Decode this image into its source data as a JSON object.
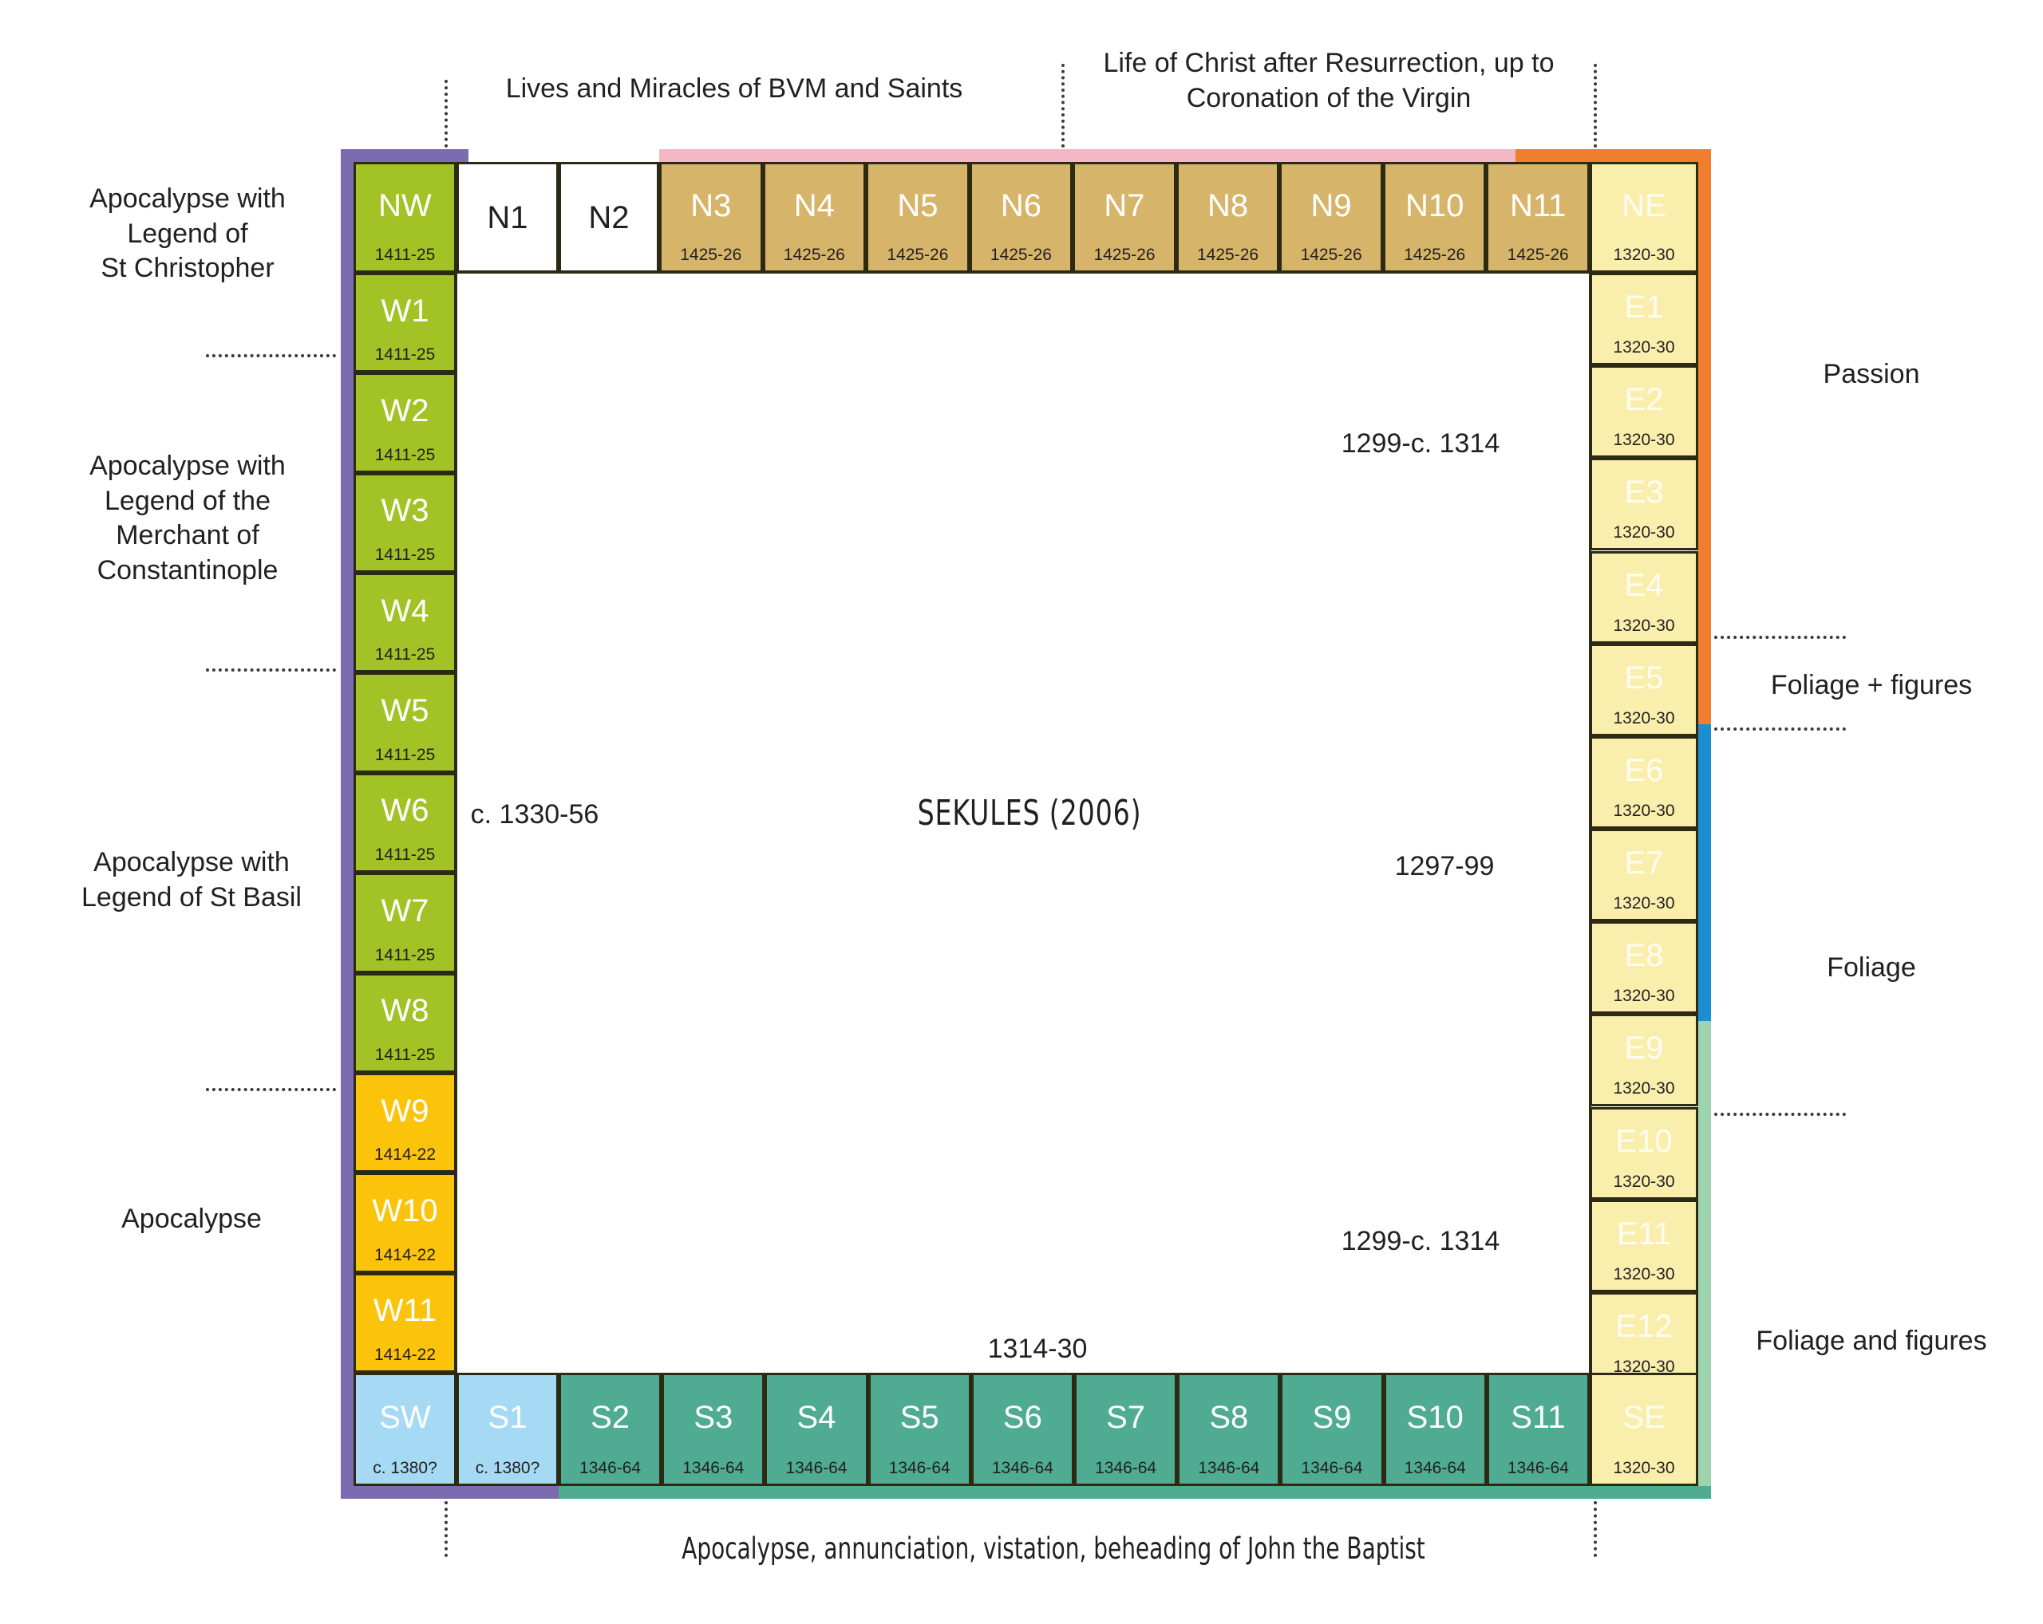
{
  "diagram": {
    "center_label": "SEKULES (2006)",
    "interior_dates": [
      {
        "text": "c. 1330-56"
      },
      {
        "text": "1299-c. 1314"
      },
      {
        "text": "1297-99"
      },
      {
        "text": "1299-c. 1314"
      },
      {
        "text": "1314-30"
      }
    ]
  },
  "captions": {
    "top_left": "Lives and Miracles of BVM and Saints",
    "top_right": "Life of Christ after Resurrection, up to\nCoronation of the Virgin",
    "bottom": "Apocalypse, annunciation, vistation, beheading of John the Baptist"
  },
  "left_labels": [
    {
      "text": "Apocalypse with\nLegend of\nSt Christopher"
    },
    {
      "text": "Apocalypse with\nLegend of the\nMerchant of\nConstantinople"
    },
    {
      "text": "Apocalypse with\nLegend of St Basil"
    },
    {
      "text": "Apocalypse"
    }
  ],
  "right_labels": [
    {
      "text": "Passion"
    },
    {
      "text": "Foliage + figures"
    },
    {
      "text": "Foliage"
    },
    {
      "text": "Foliage and figures"
    }
  ],
  "colors": {
    "green": "#a2c225",
    "white": "#ffffff",
    "tan": "#d6b56a",
    "cream": "#faeead",
    "gold": "#fcc30b",
    "lightblue": "#a6daf4",
    "teal": "#4fab92",
    "band_purple": "#7b6cb0",
    "band_pink": "#f2b8c6",
    "band_orange": "#ef7f2e",
    "band_blue": "#1d8fd1",
    "band_mint": "#9ed3b0",
    "band_darkteal": "#4fab92",
    "outline": "#2d2a14"
  },
  "north_row": [
    {
      "id": "NW",
      "date": "1411-25",
      "fill": "#a2c225",
      "label_color": "white"
    },
    {
      "id": "N1",
      "date": "",
      "fill": "#ffffff",
      "label_color": "dark"
    },
    {
      "id": "N2",
      "date": "",
      "fill": "#ffffff",
      "label_color": "dark"
    },
    {
      "id": "N3",
      "date": "1425-26",
      "fill": "#d6b56a",
      "label_color": "white"
    },
    {
      "id": "N4",
      "date": "1425-26",
      "fill": "#d6b56a",
      "label_color": "white"
    },
    {
      "id": "N5",
      "date": "1425-26",
      "fill": "#d6b56a",
      "label_color": "white"
    },
    {
      "id": "N6",
      "date": "1425-26",
      "fill": "#d6b56a",
      "label_color": "white"
    },
    {
      "id": "N7",
      "date": "1425-26",
      "fill": "#d6b56a",
      "label_color": "white"
    },
    {
      "id": "N8",
      "date": "1425-26",
      "fill": "#d6b56a",
      "label_color": "white"
    },
    {
      "id": "N9",
      "date": "1425-26",
      "fill": "#d6b56a",
      "label_color": "white"
    },
    {
      "id": "N10",
      "date": "1425-26",
      "fill": "#d6b56a",
      "label_color": "white"
    },
    {
      "id": "N11",
      "date": "1425-26",
      "fill": "#d6b56a",
      "label_color": "white"
    },
    {
      "id": "NE",
      "date": "1320-30",
      "fill": "#faeead",
      "label_color": "pale"
    }
  ],
  "west_column": [
    {
      "id": "W1",
      "date": "1411-25",
      "fill": "#a2c225",
      "label_color": "white"
    },
    {
      "id": "W2",
      "date": "1411-25",
      "fill": "#a2c225",
      "label_color": "white"
    },
    {
      "id": "W3",
      "date": "1411-25",
      "fill": "#a2c225",
      "label_color": "white"
    },
    {
      "id": "W4",
      "date": "1411-25",
      "fill": "#a2c225",
      "label_color": "white"
    },
    {
      "id": "W5",
      "date": "1411-25",
      "fill": "#a2c225",
      "label_color": "white"
    },
    {
      "id": "W6",
      "date": "1411-25",
      "fill": "#a2c225",
      "label_color": "white"
    },
    {
      "id": "W7",
      "date": "1411-25",
      "fill": "#a2c225",
      "label_color": "white"
    },
    {
      "id": "W8",
      "date": "1411-25",
      "fill": "#a2c225",
      "label_color": "white"
    },
    {
      "id": "W9",
      "date": "1414-22",
      "fill": "#fcc30b",
      "label_color": "white"
    },
    {
      "id": "W10",
      "date": "1414-22",
      "fill": "#fcc30b",
      "label_color": "white"
    },
    {
      "id": "W11",
      "date": "1414-22",
      "fill": "#fcc30b",
      "label_color": "white"
    }
  ],
  "east_column": [
    {
      "id": "E1",
      "date": "1320-30",
      "fill": "#faeead",
      "label_color": "pale"
    },
    {
      "id": "E2",
      "date": "1320-30",
      "fill": "#faeead",
      "label_color": "pale"
    },
    {
      "id": "E3",
      "date": "1320-30",
      "fill": "#faeead",
      "label_color": "pale"
    },
    {
      "id": "E4",
      "date": "1320-30",
      "fill": "#faeead",
      "label_color": "pale"
    },
    {
      "id": "E5",
      "date": "1320-30",
      "fill": "#faeead",
      "label_color": "pale"
    },
    {
      "id": "E6",
      "date": "1320-30",
      "fill": "#faeead",
      "label_color": "pale"
    },
    {
      "id": "E7",
      "date": "1320-30",
      "fill": "#faeead",
      "label_color": "pale"
    },
    {
      "id": "E8",
      "date": "1320-30",
      "fill": "#faeead",
      "label_color": "pale"
    },
    {
      "id": "E9",
      "date": "1320-30",
      "fill": "#faeead",
      "label_color": "pale"
    },
    {
      "id": "E10",
      "date": "1320-30",
      "fill": "#faeead",
      "label_color": "pale"
    },
    {
      "id": "E11",
      "date": "1320-30",
      "fill": "#faeead",
      "label_color": "pale"
    },
    {
      "id": "E12",
      "date": "1320-30",
      "fill": "#faeead",
      "label_color": "pale"
    }
  ],
  "south_row": [
    {
      "id": "SW",
      "date": "c. 1380?",
      "fill": "#a6daf4",
      "label_color": "white"
    },
    {
      "id": "S1",
      "date": "c. 1380?",
      "fill": "#a6daf4",
      "label_color": "white"
    },
    {
      "id": "S2",
      "date": "1346-64",
      "fill": "#4fab92",
      "label_color": "white"
    },
    {
      "id": "S3",
      "date": "1346-64",
      "fill": "#4fab92",
      "label_color": "white"
    },
    {
      "id": "S4",
      "date": "1346-64",
      "fill": "#4fab92",
      "label_color": "white"
    },
    {
      "id": "S5",
      "date": "1346-64",
      "fill": "#4fab92",
      "label_color": "white"
    },
    {
      "id": "S6",
      "date": "1346-64",
      "fill": "#4fab92",
      "label_color": "white"
    },
    {
      "id": "S7",
      "date": "1346-64",
      "fill": "#4fab92",
      "label_color": "white"
    },
    {
      "id": "S8",
      "date": "1346-64",
      "fill": "#4fab92",
      "label_color": "white"
    },
    {
      "id": "S9",
      "date": "1346-64",
      "fill": "#4fab92",
      "label_color": "white"
    },
    {
      "id": "S10",
      "date": "1346-64",
      "fill": "#4fab92",
      "label_color": "white"
    },
    {
      "id": "S11",
      "date": "1346-64",
      "fill": "#4fab92",
      "label_color": "white"
    },
    {
      "id": "SE",
      "date": "1320-30",
      "fill": "#faeead",
      "label_color": "pale"
    }
  ]
}
